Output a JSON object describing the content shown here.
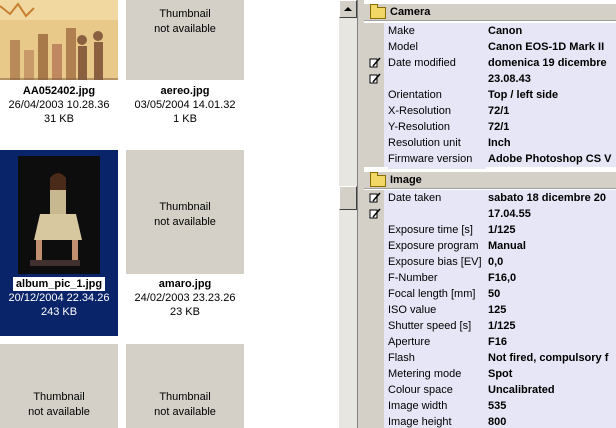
{
  "thumbnails": [
    {
      "id": "aa",
      "name": "AA052402.jpg",
      "date": "26/04/2003 10.28.36",
      "size": "31 KB",
      "has_image": true,
      "image_kind": "chart"
    },
    {
      "id": "aereo",
      "name": "aereo.jpg",
      "date": "03/05/2004 14.01.32",
      "size": "1 KB",
      "has_image": false,
      "na_line1": "Thumbnail",
      "na_line2": "not available"
    },
    {
      "id": "album",
      "name": "album_pic_1.jpg",
      "date": "20/12/2004 22.34.26",
      "size": "243 KB",
      "has_image": true,
      "image_kind": "photo",
      "selected": true
    },
    {
      "id": "amaro",
      "name": "amaro.jpg",
      "date": "24/02/2003 23.23.26",
      "size": "23 KB",
      "has_image": false,
      "na_line1": "Thumbnail",
      "na_line2": "not available"
    },
    {
      "id": "t5",
      "has_image": false,
      "na_line1": "Thumbnail",
      "na_line2": "not available"
    },
    {
      "id": "t6",
      "has_image": false,
      "na_line1": "Thumbnail",
      "na_line2": "not available"
    }
  ],
  "properties": {
    "camera": {
      "title": "Camera",
      "rows": [
        {
          "name": "Make",
          "value": "Canon"
        },
        {
          "name": "Model",
          "value": "Canon EOS-1D Mark II"
        },
        {
          "name": "Date modified",
          "value": "domenica 19 dicembre",
          "editable": true
        },
        {
          "name": "",
          "value": "23.08.43",
          "editable": true
        },
        {
          "name": "Orientation",
          "value": "Top / left side"
        },
        {
          "name": "X-Resolution",
          "value": "72/1"
        },
        {
          "name": "Y-Resolution",
          "value": "72/1"
        },
        {
          "name": "Resolution unit",
          "value": "Inch"
        },
        {
          "name": "Firmware version",
          "value": "Adobe Photoshop CS V"
        }
      ]
    },
    "image": {
      "title": "Image",
      "rows": [
        {
          "name": "Date taken",
          "value": "sabato 18 dicembre 20",
          "editable": true
        },
        {
          "name": "",
          "value": "17.04.55",
          "editable": true
        },
        {
          "name": "Exposure time [s]",
          "value": "1/125"
        },
        {
          "name": "Exposure program",
          "value": "Manual"
        },
        {
          "name": "Exposure bias [EV]",
          "value": "0,0"
        },
        {
          "name": "F-Number",
          "value": "F16,0"
        },
        {
          "name": "Focal length [mm]",
          "value": "50"
        },
        {
          "name": "ISO value",
          "value": "125"
        },
        {
          "name": "Shutter speed [s]",
          "value": "1/125"
        },
        {
          "name": "Aperture",
          "value": "F16"
        },
        {
          "name": "Flash",
          "value": "Not fired, compulsory f"
        },
        {
          "name": "Metering mode",
          "value": "Spot"
        },
        {
          "name": "Colour space",
          "value": "Uncalibrated"
        },
        {
          "name": "Image width",
          "value": "535"
        },
        {
          "name": "Image height",
          "value": "800"
        }
      ]
    }
  },
  "colors": {
    "selection": "#0a246a",
    "prop_bg": "#e6e6f6",
    "face": "#d4d0c8"
  },
  "icons": {
    "scroll_up": "arrow-up-icon",
    "folder": "folder-icon",
    "edit": "pencil-icon"
  }
}
